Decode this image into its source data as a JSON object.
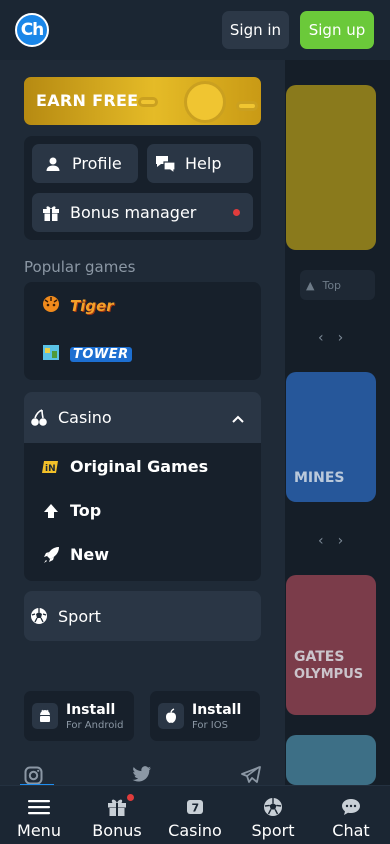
{
  "header": {
    "logo_text": "Ch",
    "signin_label": "Sign in",
    "signup_label": "Sign up"
  },
  "menu": {
    "banner_text": "EARN FREE",
    "profile_label": "Profile",
    "help_label": "Help",
    "bonus_manager_label": "Bonus manager",
    "popular_games_label": "Popular games",
    "popular_games": [
      {
        "name": "Tiger",
        "icon": "tiger-game-icon"
      },
      {
        "name": "TOWER",
        "icon": "tower-game-icon"
      }
    ],
    "casino_label": "Casino",
    "casino_items": [
      {
        "label": "Original Games",
        "icon": "original-games-icon"
      },
      {
        "label": "Top",
        "icon": "arrow-up-icon"
      },
      {
        "label": "New",
        "icon": "rocket-icon"
      }
    ],
    "sport_label": "Sport",
    "install_android": {
      "title": "Install",
      "subtitle": "For Android"
    },
    "install_ios": {
      "title": "Install",
      "subtitle": "For IOS"
    },
    "social_icons": [
      "instagram-icon",
      "twitter-icon",
      "telegram-icon"
    ]
  },
  "background": {
    "card_texts": [
      "MINES",
      "GATES",
      "OLYMPUS"
    ],
    "top_label": "Top"
  },
  "bottom_nav": [
    {
      "label": "Menu",
      "icon": "hamburger-icon"
    },
    {
      "label": "Bonus",
      "icon": "gift-icon"
    },
    {
      "label": "Casino",
      "icon": "casino-icon"
    },
    {
      "label": "Sport",
      "icon": "soccer-ball-icon"
    },
    {
      "label": "Chat",
      "icon": "chat-bubble-icon"
    }
  ],
  "colors": {
    "accent_green": "#6bc93a",
    "background": "#1b2633",
    "drawer": "#1f2a37",
    "button": "#2a3645",
    "notification_dot": "#e03c3c",
    "banner_gold": "#e5bb27"
  }
}
